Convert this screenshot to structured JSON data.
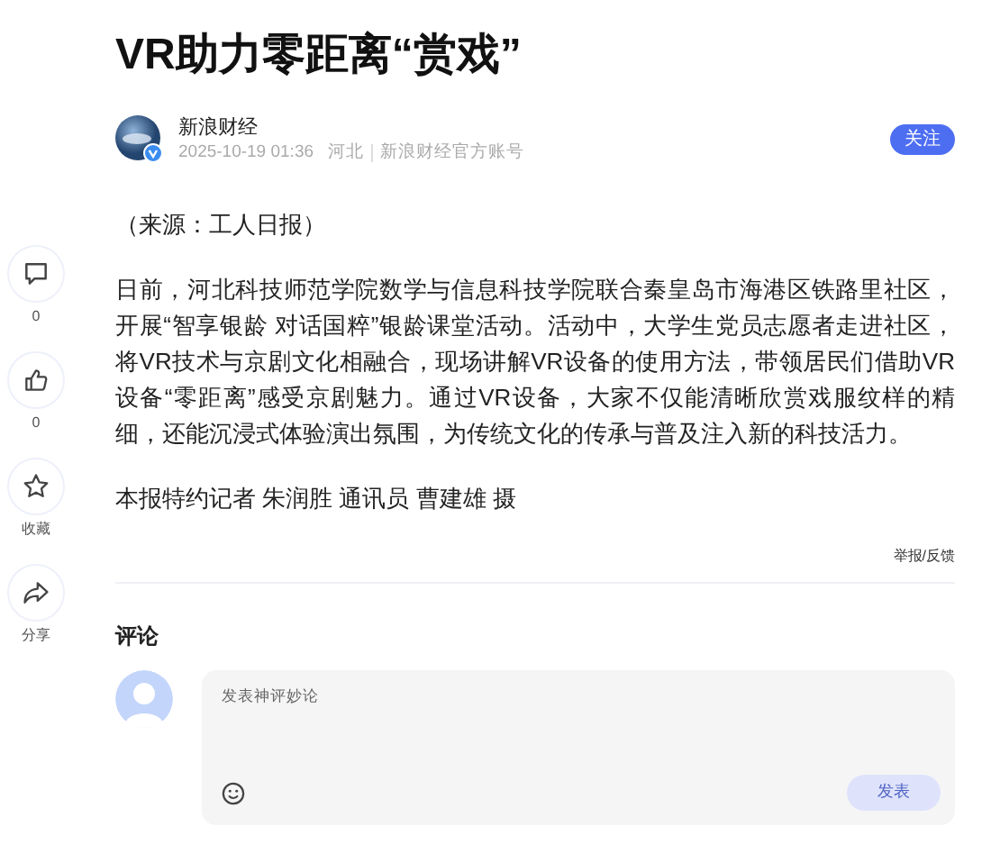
{
  "article": {
    "title": "VR助力零距离“赏戏”",
    "author": "新浪财经",
    "verified": true,
    "date": "2025-10-19 01:36",
    "location": "河北",
    "account": "新浪财经官方账号",
    "follow_button": "关注",
    "paragraphs": [
      "（来源：工人日报）",
      "日前，河北科技师范学院数学与信息科技学院联合秦皇岛市海港区铁路里社区，开展“智享银龄 对话国粹”银龄课堂活动。活动中，大学生党员志愿者走进社区，将VR技术与京剧文化相融合，现场讲解VR设备的使用方法，带领居民们借助VR设备“零距离”感受京剧魅力。通过VR设备，大家不仅能清晰欣赏戏服纹样的精细，还能沉浸式体验演出氛围，为传统文化的传承与普及注入新的科技活力。",
      "本报特约记者 朱润胜 通讯员 曹建雄 摄"
    ],
    "report_link": "举报/反馈"
  },
  "sidebar": {
    "items": [
      {
        "kind": "comment",
        "label": "0"
      },
      {
        "kind": "like",
        "label": "0"
      },
      {
        "kind": "star",
        "label": "收藏"
      },
      {
        "kind": "share",
        "label": "分享"
      }
    ]
  },
  "comments": {
    "title": "评论",
    "input": {
      "placeholder": "发表神评妙论"
    },
    "submit_button": {
      "label": "发表",
      "disabled": true
    }
  }
}
